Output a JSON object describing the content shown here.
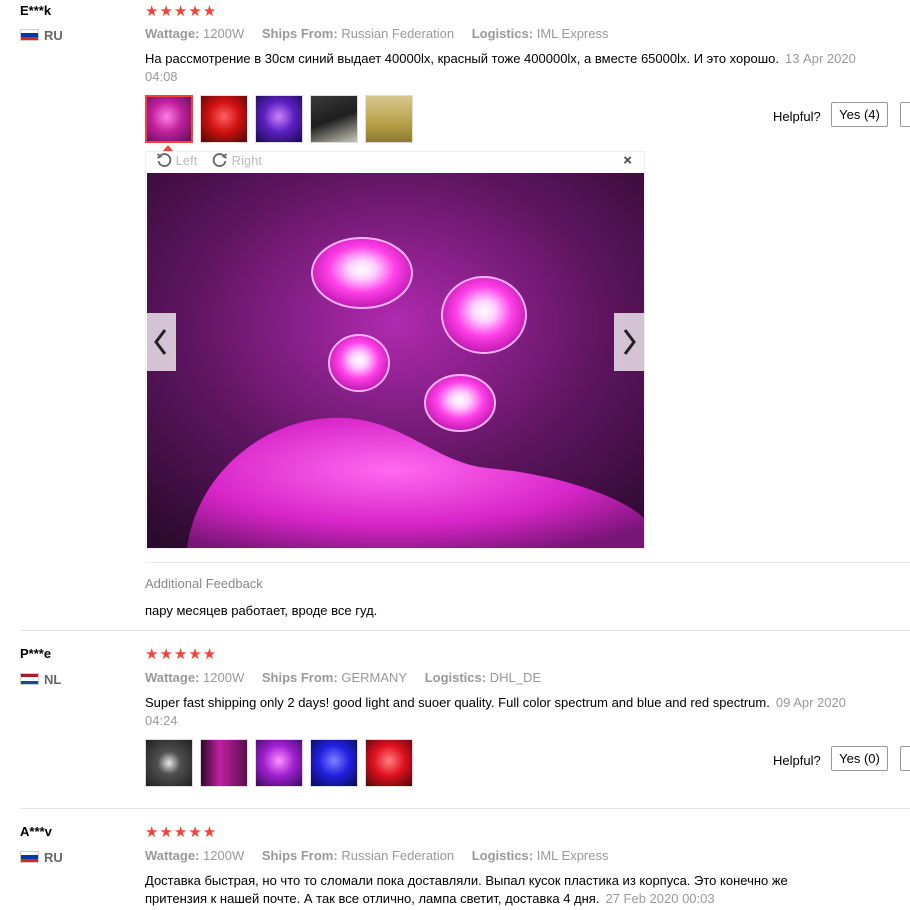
{
  "labels": {
    "wattage": "Wattage:",
    "ships_from": "Ships From:",
    "logistics": "Logistics:",
    "helpful": "Helpful?",
    "additional_feedback": "Additional Feedback"
  },
  "viewer": {
    "left_label": "Left",
    "right_label": "Right",
    "close_icon": "close-icon",
    "prev_icon": "chevron-left-icon",
    "next_icon": "chevron-right-icon"
  },
  "reviews": [
    {
      "name": "E***k",
      "country": "RU",
      "flag": [
        "#ffffff",
        "#0039a6",
        "#d52b1e"
      ],
      "stars": "★★★★★",
      "wattage": "1200W",
      "ships_from": "Russian Federation",
      "logistics": "IML Express",
      "text": "На рассмотрение в 30см синий выдает 40000lx, красный тоже 400000lx, а вместе 65000lx. И это хорошо.",
      "date": "13 Apr 2020 04:08",
      "yes": "Yes (4)",
      "additional_feedback": "пару месяцев работает, вроде все гуд."
    },
    {
      "name": "P***e",
      "country": "NL",
      "flag": [
        "#ae1c28",
        "#ffffff",
        "#21468b"
      ],
      "stars": "★★★★★",
      "wattage": "1200W",
      "ships_from": "GERMANY",
      "logistics": "DHL_DE",
      "text": "Super fast shipping only 2 days! good light and suoer quality. Full color spectrum and blue and red spectrum.",
      "date": "09 Apr 2020 04:24",
      "yes": "Yes (0)"
    },
    {
      "name": "A***v",
      "country": "RU",
      "flag": [
        "#ffffff",
        "#0039a6",
        "#d52b1e"
      ],
      "stars": "★★★★★",
      "wattage": "1200W",
      "ships_from": "Russian Federation",
      "logistics": "IML Express",
      "text": "Доставка быстрая, но что то сломали пока доставляли. Выпал кусок пластика из корпуса. Это конечно же притензия к нашей почте. А так все отлично, лампа светит, доставка 4 дня.",
      "date": "27 Feb 2020 00:03"
    }
  ]
}
